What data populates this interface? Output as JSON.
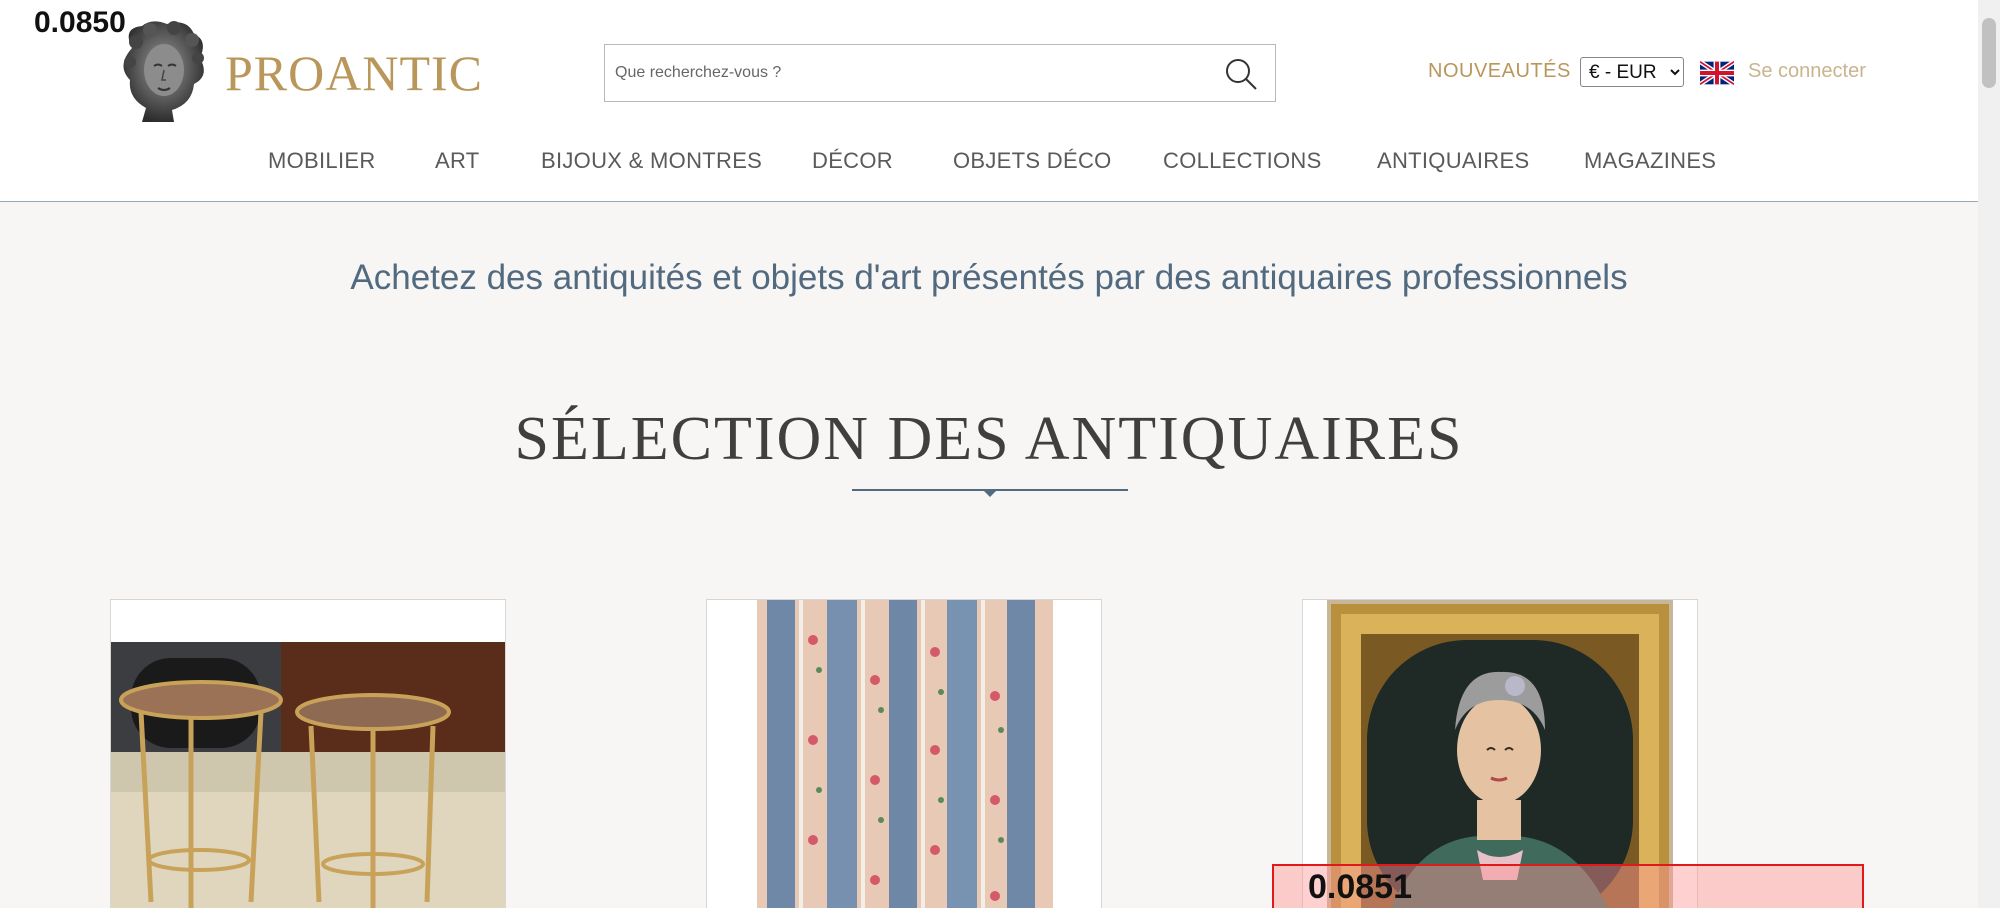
{
  "overlay": {
    "top_score": "0.0850",
    "box_score": "0.0851"
  },
  "header": {
    "brand": "PROANTIC",
    "search_placeholder": "Que recherchez-vous ?",
    "new_label": "NOUVEAUTÉS",
    "currency_selected": "€ - EUR",
    "login_label": "Se connecter"
  },
  "nav": {
    "items": [
      "MOBILIER",
      "ART",
      "BIJOUX & MONTRES",
      "DÉCOR",
      "OBJETS DÉCO",
      "COLLECTIONS",
      "ANTIQUAIRES",
      "MAGAZINES"
    ]
  },
  "main": {
    "tagline": "Achetez des antiquités et objets d'art présentés par des antiquaires professionnels",
    "section_title": "SÉLECTION DES ANTIQUAIRES"
  },
  "colors": {
    "brand_gold": "#b9975b",
    "slate_blue": "#526a80",
    "background": "#f7f6f4"
  }
}
